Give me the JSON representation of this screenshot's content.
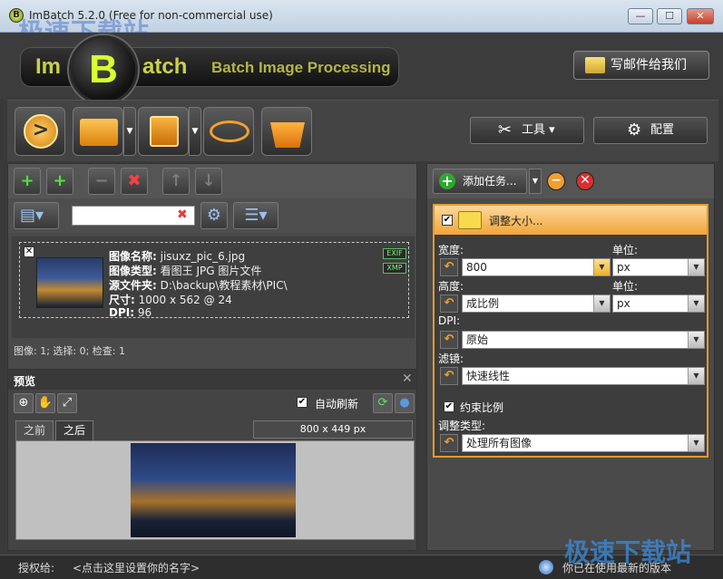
{
  "window": {
    "title": "ImBatch 5.2.0 (Free for non-commercial use)",
    "app_icon_letter": "B",
    "watermark": "极速下载站",
    "controls": {
      "minimize": "—",
      "maximize": "☐",
      "close": "✕"
    }
  },
  "header": {
    "logo_left": "Im",
    "logo_mid": "B",
    "logo_right": "atch",
    "logo_subtitle": "Batch Image Processing",
    "mail_button": "写邮件给我们"
  },
  "toolbar": {
    "run_glyph": ">",
    "drop_glyph": "▼",
    "tools_label": "工具 ▾",
    "settings_label": "配置"
  },
  "image_list": {
    "search": {
      "value": "",
      "clear": "✖"
    },
    "item": {
      "name_label": "图像名称:",
      "name": "jisuxz_pic_6.jpg",
      "type_label": "图像类型:",
      "type": "看图王 JPG 图片文件",
      "folder_label": "源文件夹:",
      "folder": "D:\\backup\\教程素材\\PIC\\",
      "size_label": "尺寸:",
      "size": "1000 x 562 @ 24",
      "dpi_label": "DPI:",
      "dpi": "96",
      "badge_exif": "EXIF",
      "badge_xmp": "XMP"
    },
    "status": "图像: 1; 选择: 0; 检查: 1"
  },
  "preview": {
    "title": "预览",
    "close": "✕",
    "auto_refresh_label": "自动刷新",
    "auto_refresh_checked": "✔",
    "tab_before": "之前",
    "tab_after": "之后",
    "dimensions": "800 x 449 px"
  },
  "tasks": {
    "add_task": "添加任务...",
    "add_icon": "+",
    "remove_icon": "−",
    "delete_icon": "✕",
    "card_title": "调整大小...",
    "checked": "✔",
    "width_label": "宽度:",
    "width_value": "800",
    "unit_label": "单位:",
    "width_unit": "px",
    "height_label": "高度:",
    "height_value": "成比例",
    "height_unit": "px",
    "dpi_label": "DPI:",
    "dpi_value": "原始",
    "filter_label": "滤镜:",
    "filter_value": "快速线性",
    "keep_ratio_label": "约束比例",
    "resize_type_label": "调整类型:",
    "resize_type_value": "处理所有图像",
    "reset_glyph": "↶",
    "arrow_glyph": "▼"
  },
  "status": {
    "license_label": "授权给:",
    "license_value": "<点击这里设置你的名字>",
    "update_text": "你已在使用最新的版本"
  }
}
